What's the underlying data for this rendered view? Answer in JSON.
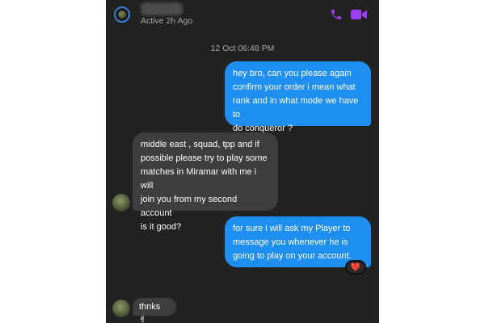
{
  "header": {
    "active_status": "Active 2h Ago",
    "phone_icon": "phone-icon",
    "video_icon": "video-camera-icon",
    "accent_color": "#9b3ff0"
  },
  "timestamp": "12 Oct 06:48 PM",
  "messages": [
    {
      "direction": "outgoing",
      "text": "hey bro, can you please again\nconfirm your order i mean what\nrank and in what mode we have to\ndo conqueror ?"
    },
    {
      "direction": "incoming",
      "text": "middle east , squad, tpp and if\npossible please try to play some\nmatches in Miramar with me i will\njoin you from my second account\nis it good?"
    },
    {
      "direction": "outgoing",
      "text": "for sure i will ask my Player to\nmessage you whenever he is\ngoing to play on your account.",
      "reaction": "❤️"
    },
    {
      "direction": "incoming",
      "text": "thnks ✌"
    }
  ],
  "colors": {
    "background": "#222222",
    "outgoing_bubble": "#1f8ef1",
    "incoming_bubble": "#3e3e3e"
  }
}
